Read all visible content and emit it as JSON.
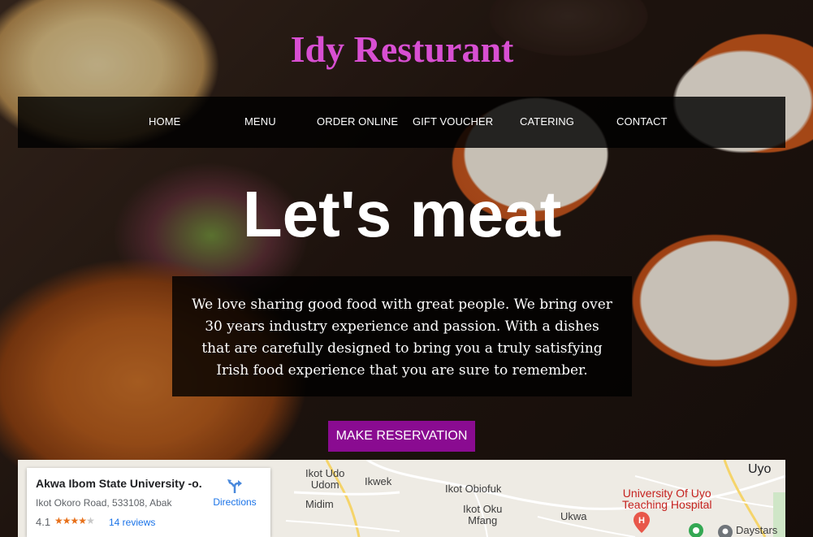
{
  "site": {
    "title": "Idy Resturant"
  },
  "nav": {
    "items": [
      {
        "label": "HOME"
      },
      {
        "label": "MENU"
      },
      {
        "label": "ORDER ONLINE"
      },
      {
        "label": "GIFT VOUCHER"
      },
      {
        "label": "CATERING"
      },
      {
        "label": "CONTACT"
      }
    ]
  },
  "hero": {
    "heading": "Let's meat",
    "intro": "We love sharing good food with great people. We bring over 30 years industry experience and passion. With a dishes that are carefully designed to bring you a truly satisfying Irish food experience that you are sure to remember.",
    "cta_label": "MAKE RESERVATION"
  },
  "map": {
    "place": {
      "name": "Akwa Ibom State University -o...",
      "address": "Ikot Okoro Road, 533108, Abak",
      "rating": "4.1",
      "reviews": "14 reviews",
      "directions_label": "Directions"
    },
    "labels": {
      "ikot_udo_udom": "Ikot Udo\nUdom",
      "ikwek": "Ikwek",
      "midim": "Midim",
      "ikot_obiofuk": "Ikot Obiofuk",
      "ikot_oku_mfang": "Ikot Oku\nMfang",
      "ukwa": "Ukwa",
      "uyo": "Uyo",
      "hospital": "University Of Uyo\nTeaching Hospital",
      "daystars": "Daystars"
    }
  },
  "colors": {
    "title": "#d84fd2",
    "cta_background": "#8a0b91",
    "nav_background": "rgba(0,0,0,0.82)"
  },
  "icons": {
    "directions": "directions-icon",
    "hospital": "hospital-icon",
    "star": "star-icon"
  }
}
